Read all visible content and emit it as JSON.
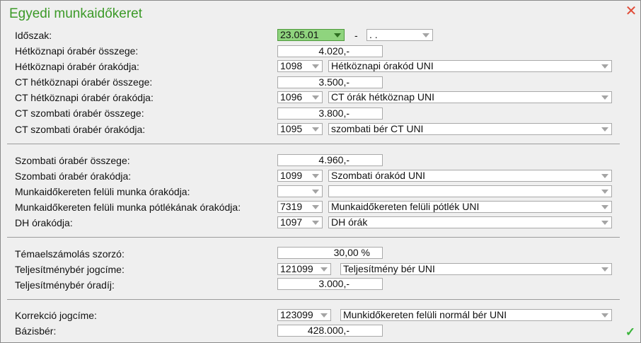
{
  "dialog": {
    "title": "Egyedi munkaidőkeret"
  },
  "rows": {
    "idoszak": {
      "label": "Időszak:",
      "from": "23.05.01",
      "sep": "-",
      "to": ". ."
    },
    "hetkoz_osszeg": {
      "label": "Hétköznapi órabér összege:",
      "value": "4.020,-"
    },
    "hetkoz_orakod": {
      "label": "Hétköznapi órabér órakódja:",
      "code": "1098",
      "name": "Hétköznapi órakód UNI"
    },
    "ct_hetkoz_osszeg": {
      "label": "CT hétköznapi órabér összege:",
      "value": "3.500,-"
    },
    "ct_hetkoz_orakod": {
      "label": "CT hétköznapi órabér órakódja:",
      "code": "1096",
      "name": "CT órák hétköznap UNI"
    },
    "ct_szomb_osszeg": {
      "label": "CT szombati órabér összege:",
      "value": "3.800,-"
    },
    "ct_szomb_orakod": {
      "label": "CT szombati órabér órakódja:",
      "code": "1095",
      "name": "szombati bér CT UNI"
    },
    "szomb_osszeg": {
      "label": "Szombati órabér összege:",
      "value": "4.960,-"
    },
    "szomb_orakod": {
      "label": "Szombati órabér órakódja:",
      "code": "1099",
      "name": "Szombati órakód UNI"
    },
    "felul_orakod": {
      "label": "Munkaidőkereten felüli munka órakódja:",
      "code": "",
      "name": ""
    },
    "felul_potlek": {
      "label": "Munkaidőkereten felüli munka pótlékának órakódja:",
      "code": "7319",
      "name": "Munkaidőkereten felüli pótlék UNI"
    },
    "dh_orakod": {
      "label": "DH órakódja:",
      "code": "1097",
      "name": "DH órák"
    },
    "tema_szorzo": {
      "label": "Témaelszámolás szorzó:",
      "value": "30,00 %"
    },
    "telj_jogcim": {
      "label": "Teljesítménybér jogcíme:",
      "code": "121099",
      "name": "Teljesítmény bér UNI"
    },
    "telj_oradij": {
      "label": "Teljesítménybér óradíj:",
      "value": "3.000,-"
    },
    "korr_jogcim": {
      "label": "Korrekció jogcíme:",
      "code": "123099",
      "name": "Munkidőkereten felüli normál bér UNI"
    },
    "bazisber": {
      "label": "Bázisbér:",
      "value": "428.000,-"
    }
  },
  "colors": {
    "title": "#3c9a28",
    "close": "#e04a36",
    "ok": "#3ab43a",
    "date_highlight": "#8fd47e"
  }
}
